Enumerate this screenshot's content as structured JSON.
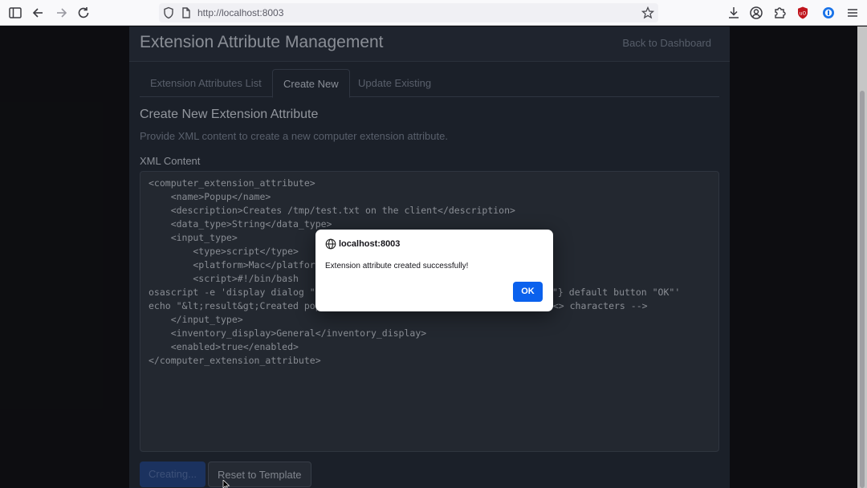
{
  "browser": {
    "url": "http://localhost:8003",
    "icons": [
      "sidebar-icon",
      "back-icon",
      "forward-icon",
      "reload-icon",
      "shield-icon",
      "page-icon",
      "bookmark-star-icon",
      "download-icon",
      "account-icon",
      "extensions-icon",
      "ublock-icon",
      "password-manager-icon",
      "menu-icon"
    ]
  },
  "card": {
    "title": "Extension Attribute Management",
    "back_link": "Back to Dashboard"
  },
  "tabs": [
    {
      "label": "Extension Attributes List",
      "active": false
    },
    {
      "label": "Create New",
      "active": true
    },
    {
      "label": "Update Existing",
      "active": false
    }
  ],
  "form": {
    "section_title": "Create New Extension Attribute",
    "description": "Provide XML content to create a new computer extension attribute.",
    "field_label": "XML Content",
    "code_lines": [
      "<computer_extension_attribute>",
      "    <name>Popup</name>",
      "    <description>Creates /tmp/test.txt on the client</description>",
      "    <data_type>String</data_type>",
      "    <input_type>",
      "        <type>script</type>",
      "        <platform>Mac</platform",
      "        <script>#!/bin/bash",
      "osascript -e 'display dialog \"I",
      "echo \"&lt;result&gt;Created pop",
      "    </input_type>",
      "    <inventory_display>General</inventory_display>",
      "    <enabled>true</enabled>",
      "</computer_extension_attribute>"
    ],
    "code_line_tail_9": "\"} default button \"OK\"'",
    "code_line_tail_10": "e <> characters -->",
    "submit_label": "Creating...",
    "reset_label": "Reset to Template"
  },
  "dialog": {
    "host": "localhost:8003",
    "message": "Extension attribute created successfully!",
    "ok_label": "OK"
  }
}
